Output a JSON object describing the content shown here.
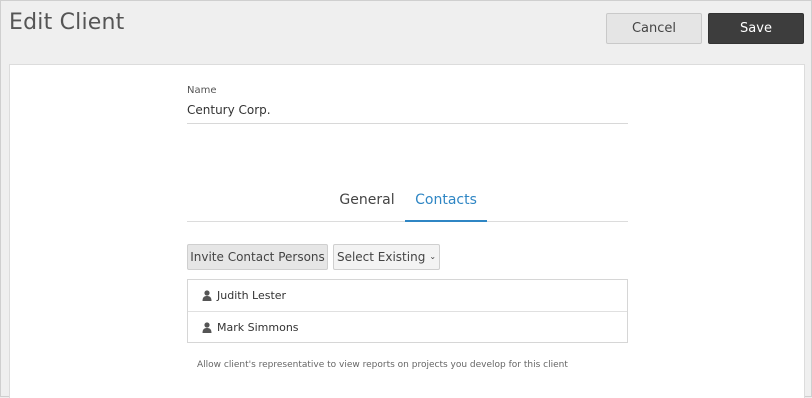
{
  "header": {
    "title": "Edit Client",
    "cancel_label": "Cancel",
    "save_label": "Save"
  },
  "form": {
    "name_label": "Name",
    "name_value": "Century Corp."
  },
  "tabs": [
    {
      "label": "General",
      "active": false
    },
    {
      "label": "Contacts",
      "active": true
    }
  ],
  "contacts": {
    "invite_label": "Invite Contact Persons",
    "select_existing_label": "Select Existing",
    "list": [
      {
        "name": "Judith Lester",
        "icon": "person-icon"
      },
      {
        "name": "Mark Simmons",
        "icon": "person-icon"
      }
    ],
    "help_text": "Allow client's representative to view reports on projects you develop for this client"
  },
  "colors": {
    "accent": "#2f86c4",
    "save_bg": "#3d3d3d",
    "page_bg": "#efefef"
  }
}
